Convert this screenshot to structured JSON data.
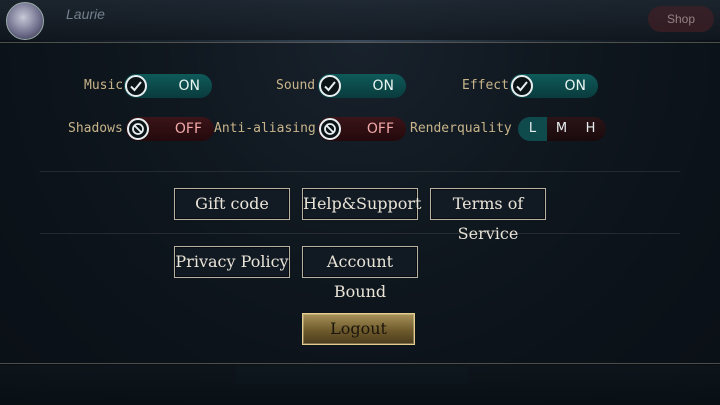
{
  "background": {
    "player_name": "Laurie",
    "shop_label": "Shop"
  },
  "options": {
    "music": {
      "label": "Music",
      "state": "ON"
    },
    "sound": {
      "label": "Sound",
      "state": "ON"
    },
    "effect": {
      "label": "Effect",
      "state": "ON"
    },
    "shadows": {
      "label": "Shadows",
      "state": "OFF"
    },
    "anti_aliasing": {
      "label": "Anti-aliasing",
      "state": "OFF"
    },
    "render_quality": {
      "label": "Renderquality",
      "options": [
        "L",
        "M",
        "H"
      ],
      "selected": "L"
    }
  },
  "buttons": {
    "gift_code": "Gift code",
    "help_support": "Help&Support",
    "terms": "Terms of Service",
    "privacy": "Privacy Policy",
    "account_bound": "Account Bound",
    "logout": "Logout"
  },
  "icons": {
    "on": "check-icon",
    "off": "prohibited-icon"
  },
  "colors": {
    "label": "#c8b48a",
    "toggle_on": "#0f5a5a",
    "toggle_off": "#3a1418",
    "logout_gold": "#a8925a"
  }
}
